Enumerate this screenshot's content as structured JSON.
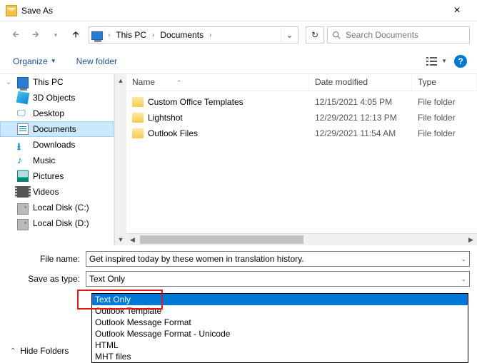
{
  "window": {
    "title": "Save As"
  },
  "breadcrumb": {
    "root": "This PC",
    "folder": "Documents"
  },
  "search": {
    "placeholder": "Search Documents"
  },
  "toolbar": {
    "organize": "Organize",
    "new_folder": "New folder",
    "help": "?"
  },
  "sidebar": {
    "items": [
      {
        "label": "This PC"
      },
      {
        "label": "3D Objects"
      },
      {
        "label": "Desktop"
      },
      {
        "label": "Documents"
      },
      {
        "label": "Downloads"
      },
      {
        "label": "Music"
      },
      {
        "label": "Pictures"
      },
      {
        "label": "Videos"
      },
      {
        "label": "Local Disk (C:)"
      },
      {
        "label": "Local Disk (D:)"
      }
    ]
  },
  "columns": {
    "name": "Name",
    "date": "Date modified",
    "type": "Type"
  },
  "files": [
    {
      "name": "Custom Office Templates",
      "date": "12/15/2021 4:05 PM",
      "type": "File folder"
    },
    {
      "name": "Lightshot",
      "date": "12/29/2021 12:13 PM",
      "type": "File folder"
    },
    {
      "name": "Outlook Files",
      "date": "12/29/2021 11:54 AM",
      "type": "File folder"
    }
  ],
  "form": {
    "file_name_label": "File name:",
    "file_name_value": "Get inspired today by these women in translation history.",
    "save_type_label": "Save as type:",
    "save_type_value": "Text Only"
  },
  "dropdown_options": [
    "Text Only",
    "Outlook Template",
    "Outlook Message Format",
    "Outlook Message Format - Unicode",
    "HTML",
    "MHT files"
  ],
  "footer": {
    "hide_folders": "Hide Folders"
  }
}
